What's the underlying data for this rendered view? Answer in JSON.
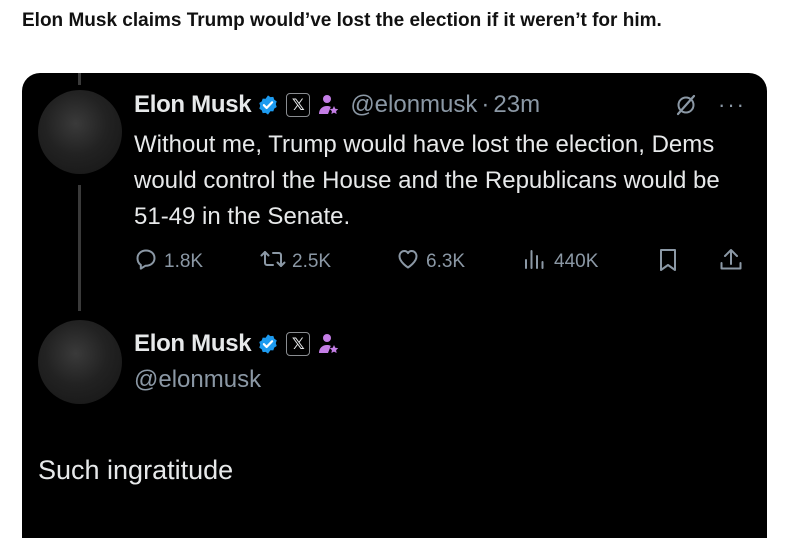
{
  "headline": "Elon Musk claims Trump would’ve lost the election if it weren’t for him.",
  "tweet": {
    "author_name": "Elon Musk",
    "handle": "@elonmusk",
    "separator": "·",
    "time": "23m",
    "x_badge": "𝕏",
    "text": "Without me, Trump would have lost the election, Dems would control the House and the Republicans would be 51-49 in the Senate.",
    "actions": {
      "replies": "1.8K",
      "reposts": "2.5K",
      "likes": "6.3K",
      "views": "440K"
    },
    "more_label": "···"
  },
  "reply": {
    "author_name": "Elon Musk",
    "handle": "@elonmusk",
    "x_badge": "𝕏",
    "text": "Such ingratitude"
  },
  "colors": {
    "card_bg": "#000000",
    "text_primary": "#e7e9ea",
    "text_secondary": "#8b98a5",
    "verified_blue": "#1d9bf0",
    "affiliate_purple": "#c47ee6"
  },
  "icons": [
    "verified-badge-icon",
    "x-logo-badge-icon",
    "affiliate-badge-icon",
    "grok-icon",
    "more-icon",
    "reply-icon",
    "repost-icon",
    "like-icon",
    "views-icon",
    "bookmark-icon",
    "share-icon"
  ]
}
